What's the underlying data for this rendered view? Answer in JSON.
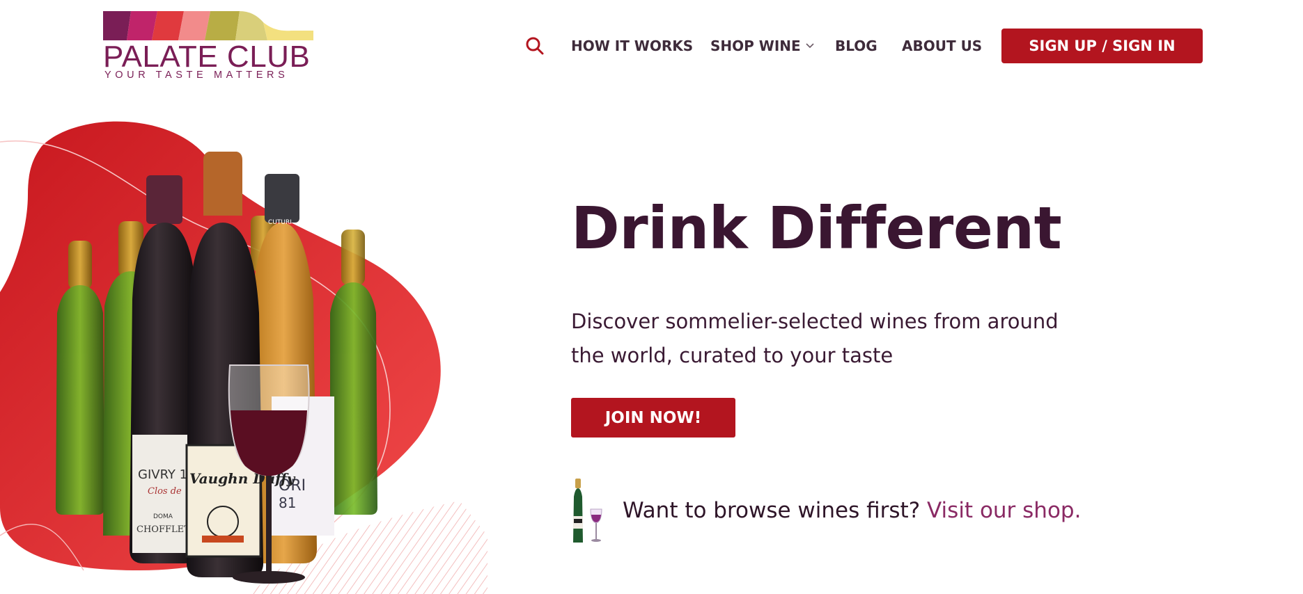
{
  "brand": {
    "name": "PALATE CLUB",
    "tagline": "YOUR TASTE MATTERS",
    "colors": [
      "#7a1e56",
      "#c0246a",
      "#e03a3e",
      "#f28b8b",
      "#b8ad45",
      "#e0d98a",
      "#f3e07f"
    ]
  },
  "nav": {
    "search_icon": "search-icon",
    "links": [
      "HOW IT WORKS",
      "SHOP WINE",
      "BLOG",
      "ABOUT US"
    ],
    "cta": "SIGN UP / SIGN IN"
  },
  "hero": {
    "headline": "Drink Different",
    "subtext": "Discover sommelier-selected wines from around the world, curated to your taste",
    "join_label": "JOIN NOW!",
    "browse_prefix": "Want to browse wines first?",
    "browse_link": "Visit our shop.",
    "bottle_labels": [
      "GIVRY 1",
      "Clos de",
      "DOMA",
      "CHOFFLET V",
      "Vaughn Duffy",
      "ORI",
      "81",
      "CUTURI"
    ]
  },
  "colors": {
    "accent": "#b3151f",
    "text": "#3a1631",
    "link": "#8a2a64"
  }
}
